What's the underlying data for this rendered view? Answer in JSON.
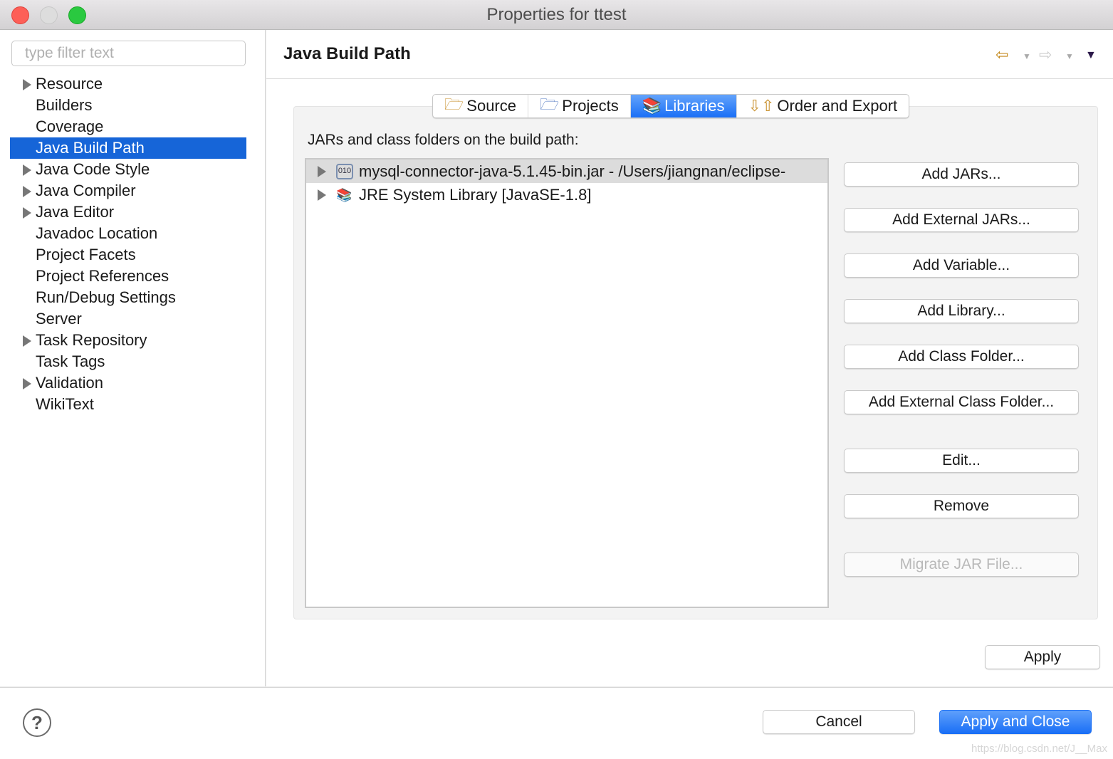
{
  "window": {
    "title": "Properties for ttest"
  },
  "sidebar": {
    "filter_placeholder": "type filter text",
    "items": [
      {
        "label": "Resource",
        "expandable": true
      },
      {
        "label": "Builders",
        "expandable": false
      },
      {
        "label": "Coverage",
        "expandable": false
      },
      {
        "label": "Java Build Path",
        "expandable": false,
        "selected": true
      },
      {
        "label": "Java Code Style",
        "expandable": true
      },
      {
        "label": "Java Compiler",
        "expandable": true
      },
      {
        "label": "Java Editor",
        "expandable": true
      },
      {
        "label": "Javadoc Location",
        "expandable": false
      },
      {
        "label": "Project Facets",
        "expandable": false
      },
      {
        "label": "Project References",
        "expandable": false
      },
      {
        "label": "Run/Debug Settings",
        "expandable": false
      },
      {
        "label": "Server",
        "expandable": false
      },
      {
        "label": "Task Repository",
        "expandable": true
      },
      {
        "label": "Task Tags",
        "expandable": false
      },
      {
        "label": "Validation",
        "expandable": true
      },
      {
        "label": "WikiText",
        "expandable": false
      }
    ]
  },
  "page": {
    "title": "Java Build Path",
    "tabs": [
      {
        "label": "Source"
      },
      {
        "label": "Projects"
      },
      {
        "label": "Libraries",
        "active": true
      },
      {
        "label": "Order and Export"
      }
    ],
    "list_label": "JARs and class folders on the build path:",
    "entries": [
      {
        "label": "mysql-connector-java-5.1.45-bin.jar - /Users/jiangnan/eclipse-",
        "icon": "jar-icon"
      },
      {
        "label": "JRE System Library [JavaSE-1.8]",
        "icon": "library-icon"
      }
    ],
    "buttons": {
      "add_jars": "Add JARs...",
      "add_external_jars": "Add External JARs...",
      "add_variable": "Add Variable...",
      "add_library": "Add Library...",
      "add_class_folder": "Add Class Folder...",
      "add_external_class_folder": "Add External Class Folder...",
      "edit": "Edit...",
      "remove": "Remove",
      "migrate": "Migrate JAR File...",
      "apply": "Apply"
    }
  },
  "footer": {
    "cancel": "Cancel",
    "apply_close": "Apply and Close",
    "help": "?",
    "watermark": "https://blog.csdn.net/J__Max"
  },
  "colors": {
    "accent": "#1a6ff6",
    "selection": "#1665d8"
  }
}
